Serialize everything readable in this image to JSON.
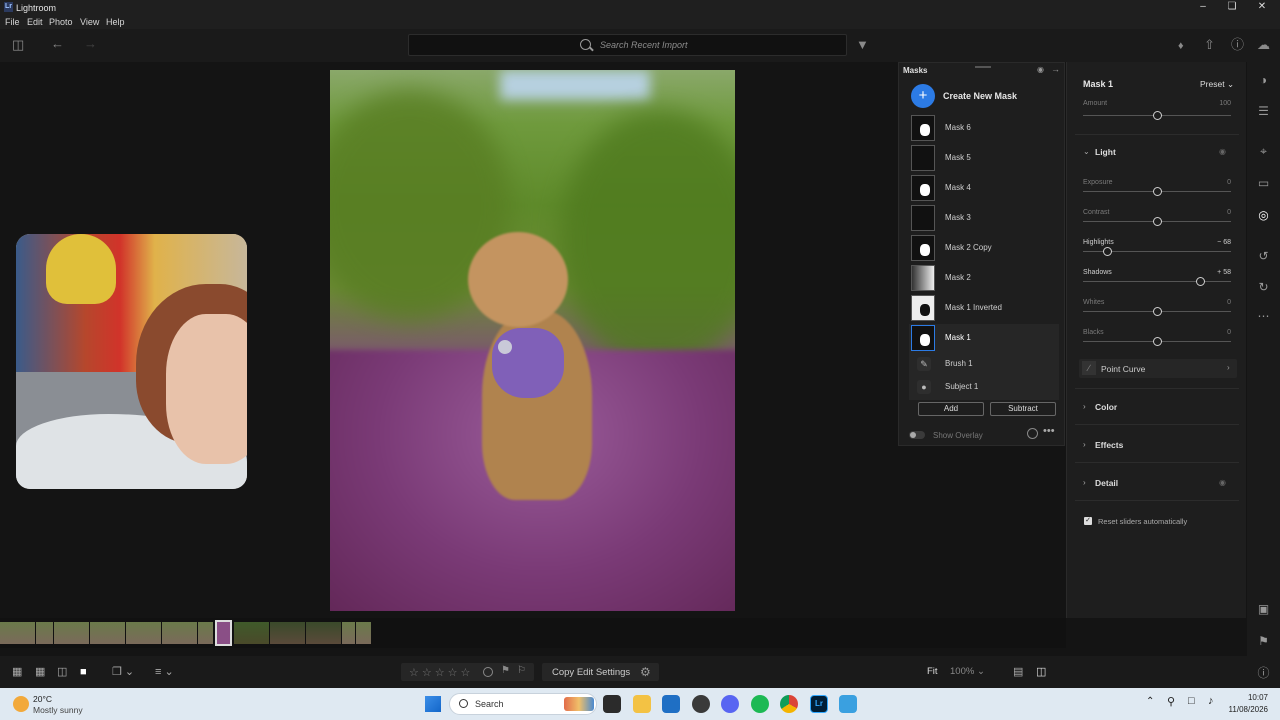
{
  "window": {
    "app_name": "Lightroom"
  },
  "menu": [
    "File",
    "Edit",
    "Photo",
    "View",
    "Help"
  ],
  "toolbar": {
    "search_placeholder": "Search Recent Import"
  },
  "masks_panel": {
    "title": "Masks",
    "create_label": "Create New Mask",
    "masks": [
      "Mask 6",
      "Mask 5",
      "Mask 4",
      "Mask 3",
      "Mask 2 Copy",
      "Mask 2",
      "Mask 1 Inverted",
      "Mask 1"
    ],
    "selected": "Mask 1",
    "components": [
      "Brush 1",
      "Subject 1"
    ],
    "add_label": "Add",
    "subtract_label": "Subtract",
    "overlay_label": "Show Overlay"
  },
  "edit_panel": {
    "mask_name": "Mask 1",
    "preset_label": "Preset",
    "amount": {
      "label": "Amount",
      "value": "100"
    },
    "light_title": "Light",
    "sliders": [
      {
        "label": "Exposure",
        "value": "0",
        "pos": 0.5
      },
      {
        "label": "Contrast",
        "value": "0",
        "pos": 0.5
      },
      {
        "label": "Highlights",
        "value": "− 68",
        "pos": 0.16
      },
      {
        "label": "Shadows",
        "value": "+ 58",
        "pos": 0.79
      },
      {
        "label": "Whites",
        "value": "0",
        "pos": 0.5
      },
      {
        "label": "Blacks",
        "value": "0",
        "pos": 0.5
      }
    ],
    "point_curve": "Point Curve",
    "sections": [
      "Color",
      "Effects",
      "Detail"
    ],
    "reset_label": "Reset sliders automatically"
  },
  "bottom": {
    "copy_label": "Copy Edit Settings",
    "fit_label": "Fit",
    "zoom_label": "100%"
  },
  "taskbar": {
    "weather_temp": "20°C",
    "weather_desc": "Mostly sunny",
    "search_label": "Search",
    "time": "10:07",
    "date": "11/08/2026"
  },
  "colors": {
    "accent": "#2c7be5",
    "panel": "#1e1e1e"
  }
}
